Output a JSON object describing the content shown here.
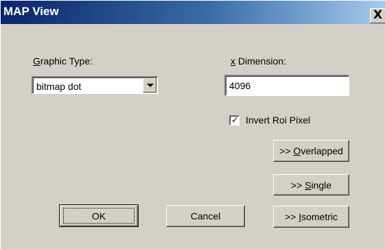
{
  "window": {
    "title": "MAP View",
    "close_glyph": "X"
  },
  "graphic_type": {
    "label_access_key": "G",
    "label_rest": "raphic Type:",
    "selected": "bitmap dot"
  },
  "x_dimension": {
    "label_access_key": "x",
    "label_rest": " Dimension:",
    "value": "4096"
  },
  "invert_roi": {
    "label": "Invert Roi Pixel",
    "checked": true,
    "check_glyph": "✓"
  },
  "buttons": {
    "overlapped": {
      "prefix": ">> ",
      "access_key": "O",
      "rest": "verlapped"
    },
    "single": {
      "prefix": ">> ",
      "access_key": "S",
      "rest": "ingle"
    },
    "isometric": {
      "prefix": ">> ",
      "access_key": "I",
      "rest": "sometric"
    },
    "ok": {
      "label": "OK"
    },
    "cancel": {
      "label": "Cancel"
    }
  },
  "colors": {
    "title_start": "#0a246a",
    "title_end": "#a6caf0",
    "face": "#d4d0c8"
  }
}
